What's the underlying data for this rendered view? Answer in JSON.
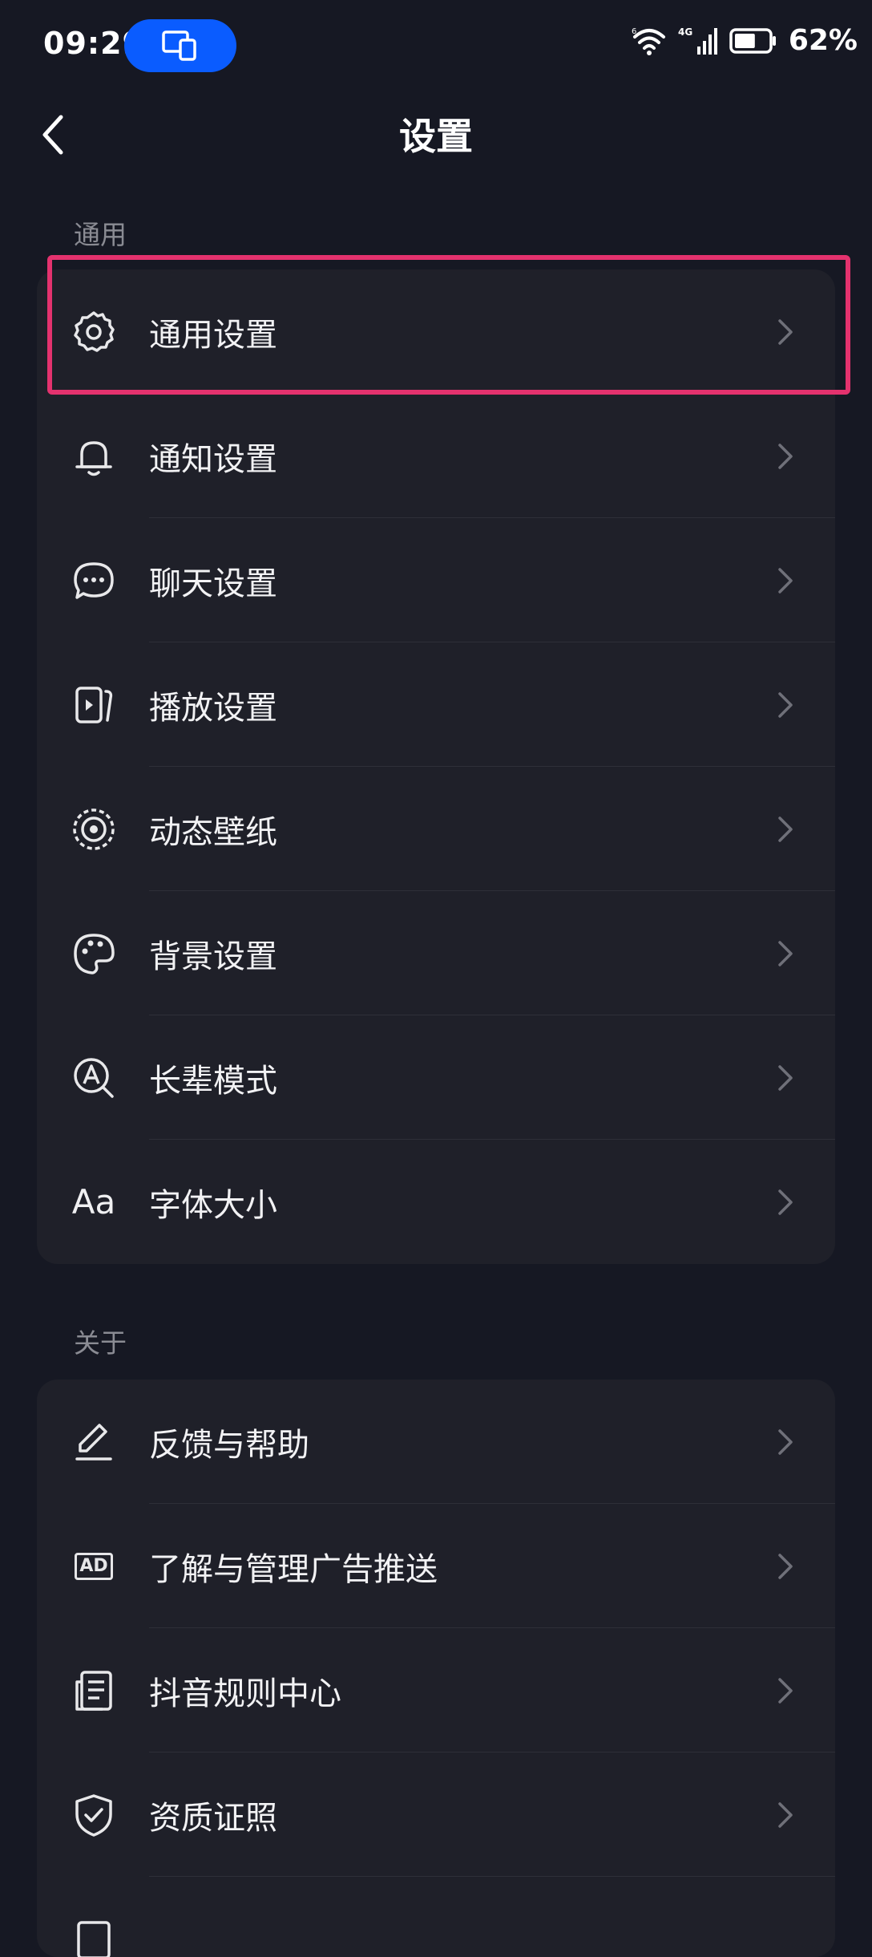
{
  "status_bar": {
    "time": "09:29",
    "network": "4G",
    "wifi_badge": "6",
    "battery": "62%",
    "battery_level": 0.62
  },
  "header": {
    "title": "设置"
  },
  "sections": [
    {
      "label": "通用",
      "items": [
        {
          "label": "通用设置",
          "icon": "gear-icon"
        },
        {
          "label": "通知设置",
          "icon": "bell-icon"
        },
        {
          "label": "聊天设置",
          "icon": "chat-bubble-icon"
        },
        {
          "label": "播放设置",
          "icon": "play-screen-icon"
        },
        {
          "label": "动态壁纸",
          "icon": "live-wallpaper-icon"
        },
        {
          "label": "背景设置",
          "icon": "palette-icon"
        },
        {
          "label": "长辈模式",
          "icon": "elder-mode-icon"
        },
        {
          "label": "字体大小",
          "icon": "font-size-icon",
          "icon_text": "Aa"
        }
      ]
    },
    {
      "label": "关于",
      "items": [
        {
          "label": "反馈与帮助",
          "icon": "edit-pen-icon"
        },
        {
          "label": "了解与管理广告推送",
          "icon": "ad-icon",
          "icon_text": "AD"
        },
        {
          "label": "抖音规则中心",
          "icon": "document-icon"
        },
        {
          "label": "资质证照",
          "icon": "shield-check-icon"
        }
      ]
    }
  ],
  "colors": {
    "background": "#161823",
    "card": "#1f2029",
    "highlight": "#e4326e",
    "pill": "#0a5cff"
  }
}
